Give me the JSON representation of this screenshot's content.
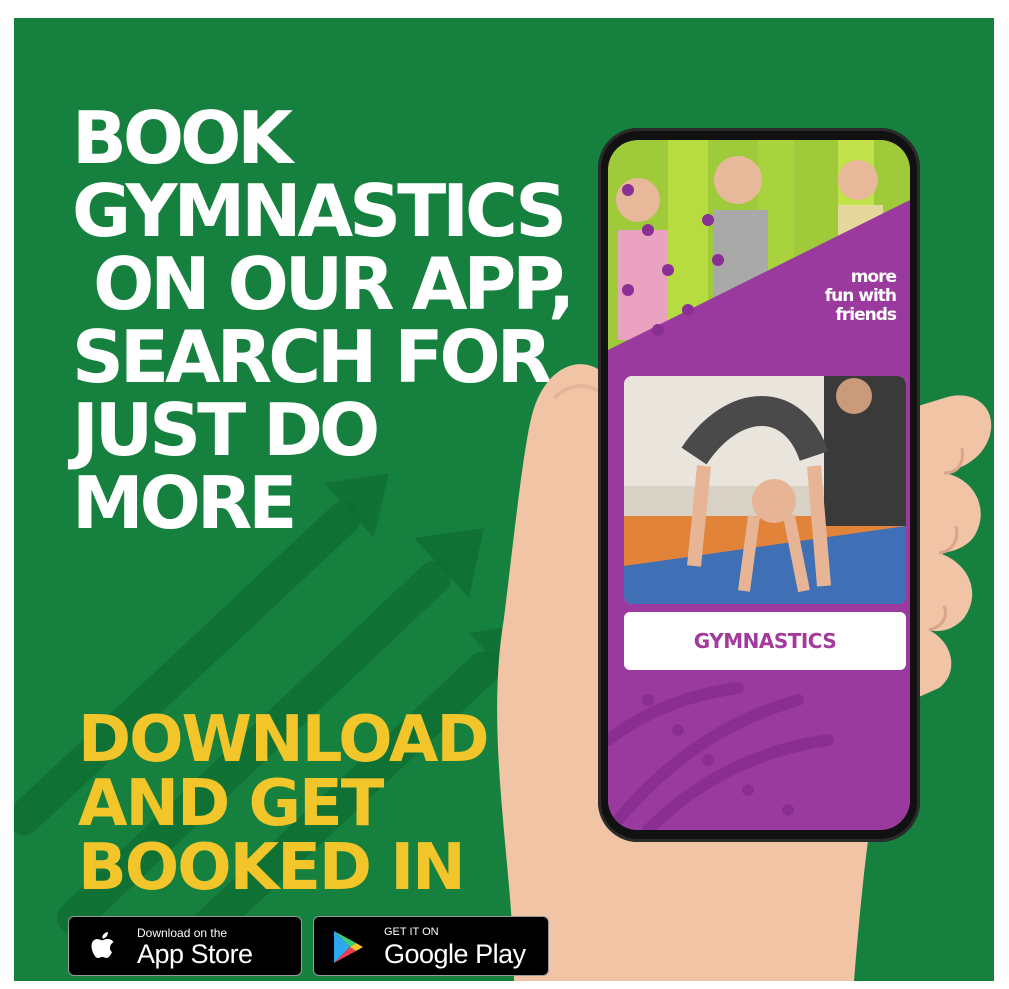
{
  "colors": {
    "background": "#16813f",
    "headline": "#ffffff",
    "cta": "#f2c52a",
    "app_purple": "#9b3a9e",
    "tile_text": "#a33a9c"
  },
  "headline_lines": [
    "BOOK",
    "GYMNASTICS",
    " ON OUR APP,",
    "SEARCH FOR",
    "JUST DO",
    "MORE"
  ],
  "cta_lines": [
    "DOWNLOAD",
    "AND GET",
    "BOOKED IN"
  ],
  "app_store": {
    "small": "Download on the",
    "big": "App Store",
    "icon": "apple-icon"
  },
  "google_play": {
    "small": "GET IT ON",
    "big": "Google Play",
    "icon": "play-icon"
  },
  "phone": {
    "banner_lines": [
      "more",
      "fun with",
      "friends"
    ],
    "tile_label": "GYMNASTICS"
  }
}
